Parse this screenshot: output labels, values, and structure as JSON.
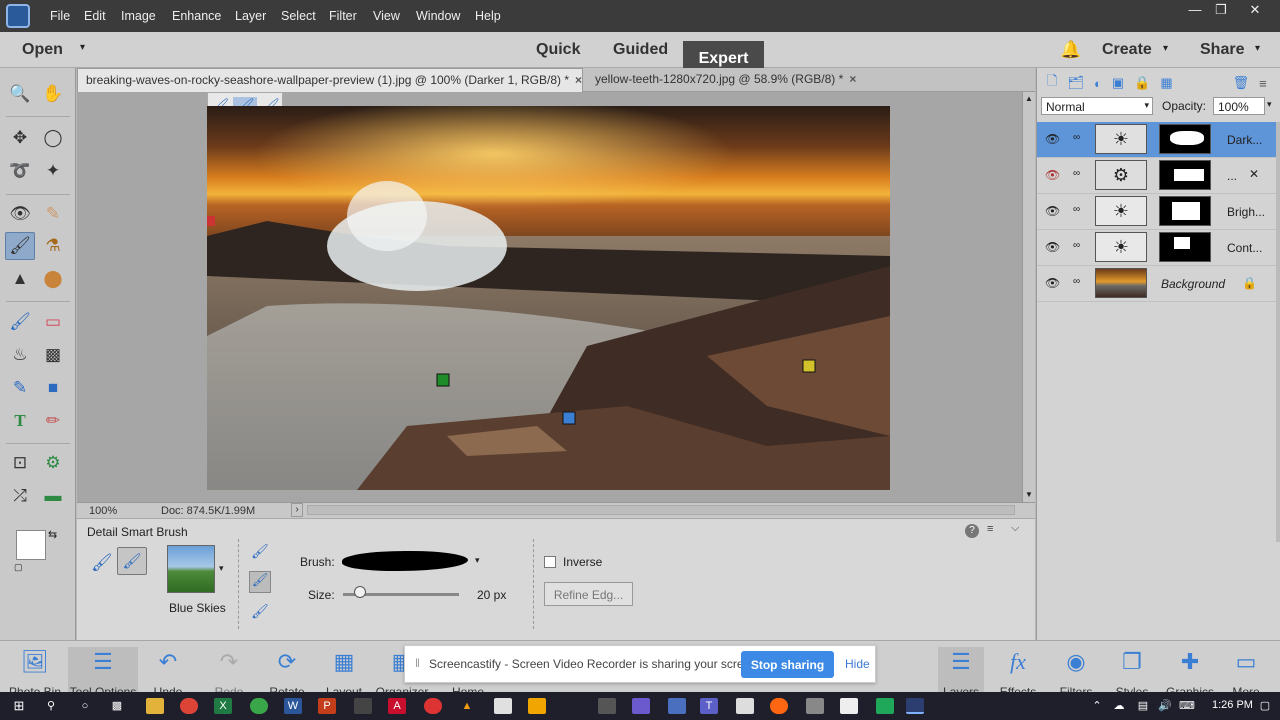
{
  "menubar": {
    "items": [
      "File",
      "Edit",
      "Image",
      "Enhance",
      "Layer",
      "Select",
      "Filter",
      "View",
      "Window",
      "Help"
    ]
  },
  "modebar": {
    "open_label": "Open",
    "modes": [
      "Quick",
      "Guided",
      "Expert"
    ],
    "active_mode": "Expert",
    "create_label": "Create",
    "share_label": "Share"
  },
  "tabs": [
    {
      "title": "breaking-waves-on-rocky-seashore-wallpaper-preview (1).jpg @ 100% (Darker 1, RGB/8) *",
      "close": "×",
      "active": true
    },
    {
      "title": "yellow-teeth-1280x720.jpg @ 58.9% (RGB/8) *",
      "close": "×",
      "active": false
    }
  ],
  "status": {
    "zoom": "100%",
    "doc": "Doc: 874.5K/1.99M",
    "arrow": "›"
  },
  "options": {
    "title": "Detail Smart Brush",
    "preset_label": "Blue Skies",
    "brush_label": "Brush:",
    "size_label": "Size:",
    "size_value": "20 px",
    "size_fraction": 0.15,
    "inverse_label": "Inverse",
    "refine_label": "Refine Edg...",
    "help_icon": "?"
  },
  "layers_panel": {
    "blend_mode": "Normal",
    "opacity_label": "Opacity:",
    "opacity_value": "100%",
    "layers": [
      {
        "name": "Dark...",
        "visible": true,
        "selected": true
      },
      {
        "name": "...",
        "visible": false,
        "selected": false
      },
      {
        "name": "Brigh...",
        "visible": true,
        "selected": false
      },
      {
        "name": "Cont...",
        "visible": true,
        "selected": false
      },
      {
        "name": "Background",
        "visible": true,
        "selected": false
      }
    ]
  },
  "bottombar": {
    "left": [
      {
        "label": "Photo Bin",
        "icon": "photo-bin-icon"
      },
      {
        "label": "Tool Options",
        "icon": "tool-options-icon"
      },
      {
        "label": "Undo",
        "icon": "undo-icon"
      },
      {
        "label": "Redo",
        "icon": "redo-icon"
      },
      {
        "label": "Rotate",
        "icon": "rotate-icon"
      },
      {
        "label": "Layout",
        "icon": "layout-icon"
      },
      {
        "label": "Organizer",
        "icon": "organizer-icon"
      },
      {
        "label": "Home Screen",
        "icon": "home-screen-icon"
      }
    ],
    "right": [
      {
        "label": "Layers",
        "icon": "layers-icon"
      },
      {
        "label": "Effects",
        "icon": "effects-icon"
      },
      {
        "label": "Filters",
        "icon": "filters-icon"
      },
      {
        "label": "Styles",
        "icon": "styles-icon"
      },
      {
        "label": "Graphics",
        "icon": "graphics-icon"
      },
      {
        "label": "More",
        "icon": "more-icon"
      }
    ]
  },
  "notification": {
    "text": "Screencastify - Screen Video Recorder is sharing your screen.",
    "stop_label": "Stop sharing",
    "hide_label": "Hide"
  },
  "taskbar": {
    "time": "1:26 PM"
  },
  "colors": {
    "accent": "#3b7fd4",
    "selected_layer": "#5e94d8",
    "stop_button": "#3d8ae6"
  }
}
